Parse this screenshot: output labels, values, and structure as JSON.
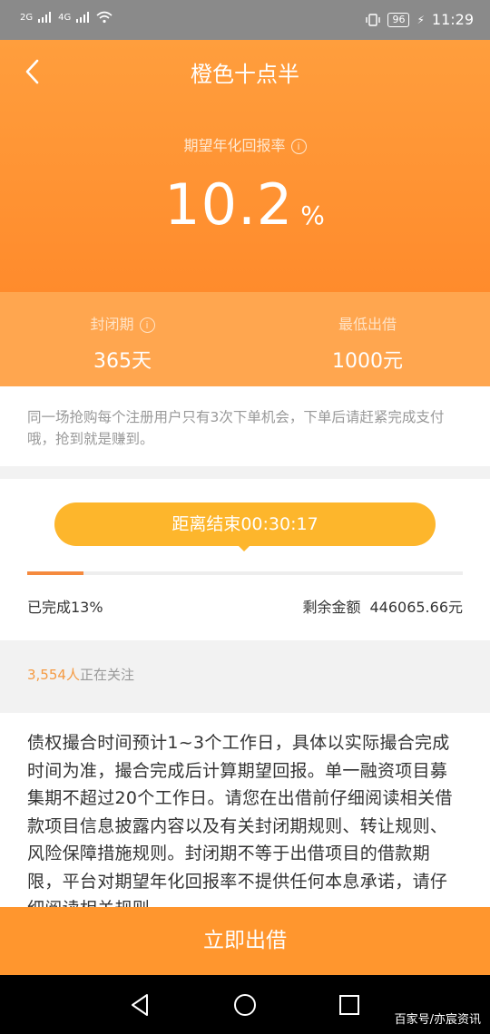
{
  "status_bar": {
    "network_left": "2G",
    "network_right": "4G",
    "battery": "96",
    "time": "11:29"
  },
  "header": {
    "title": "橙色十点半",
    "back_icon": "chevron-left-icon"
  },
  "rate": {
    "label": "期望年化回报率",
    "value": "10.2",
    "unit": "%"
  },
  "stats": {
    "lock_label": "封闭期",
    "lock_value": "365天",
    "min_label": "最低出借",
    "min_value": "1000元"
  },
  "notice": {
    "text": "同一场抢购每个注册用户只有3次下单机会，下单后请赶紧完成支付哦，抢到就是赚到。"
  },
  "progress": {
    "countdown": "距离结束00:30:17",
    "percent": 13,
    "done_label": "已完成13%",
    "remaining_label": "剩余金额",
    "remaining_value": "446065.66元"
  },
  "follow": {
    "count": "3,554人",
    "text": "正在关注"
  },
  "description": {
    "text": "债权撮合时间预计1~3个工作日，具体以实际撮合完成时间为准，撮合完成后计算期望回报。单一融资项目募集期不超过20个工作日。请您在出借前仔细阅读相关借款项目信息披露内容以及有关封闭期规则、转让规则、风险保障措施规则。封闭期不等于出借项目的借款期限，平台对期望年化回报率不提供任何本息承诺，请仔细阅读相关规则"
  },
  "cta": {
    "label": "立即出借"
  },
  "watermark": "百家号/亦宸资讯",
  "colors": {
    "brand_orange": "#ff962e",
    "countdown_yellow": "#fdb62c",
    "progress_fill": "#f58a3e"
  }
}
